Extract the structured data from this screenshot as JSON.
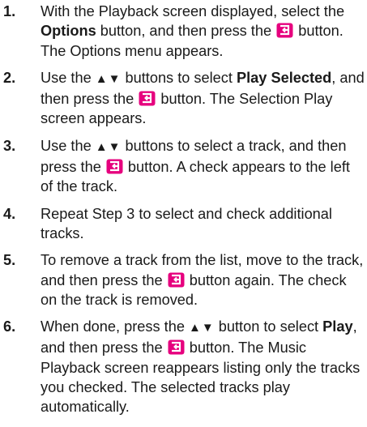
{
  "steps": [
    {
      "num": "1.",
      "a": "With the Playback screen displayed, select the ",
      "b": "Options",
      "c": " button, and then press the ",
      "d": " button. The Options menu appears."
    },
    {
      "num": "2.",
      "a": "Use the ",
      "arrows": "▲▼",
      "b": " buttons to select ",
      "c": "Play Selected",
      "d": ", and then press the ",
      "e": " button. The Selection Play screen appears."
    },
    {
      "num": "3.",
      "a": "Use the ",
      "arrows": "▲▼",
      "b": " buttons to select a track, and then press the ",
      "c": " button. A check appears to the left of the track."
    },
    {
      "num": "4.",
      "a": "Repeat Step 3 to select and check additional tracks."
    },
    {
      "num": "5.",
      "a": "To remove a track from the list, move to the track, and then press the ",
      "b": " button again. The check on the track is removed."
    },
    {
      "num": "6.",
      "a": "When done, press the ",
      "arrows": "▲▼",
      "b": " button to select ",
      "c": "Play",
      "d": ", and then press the ",
      "e": " button. The Music Playback screen reappears listing only the tracks you checked. The selected tracks play automatically."
    }
  ],
  "icons": {
    "enter": "enter-button-icon",
    "arrows": "up-down-arrow-buttons"
  }
}
